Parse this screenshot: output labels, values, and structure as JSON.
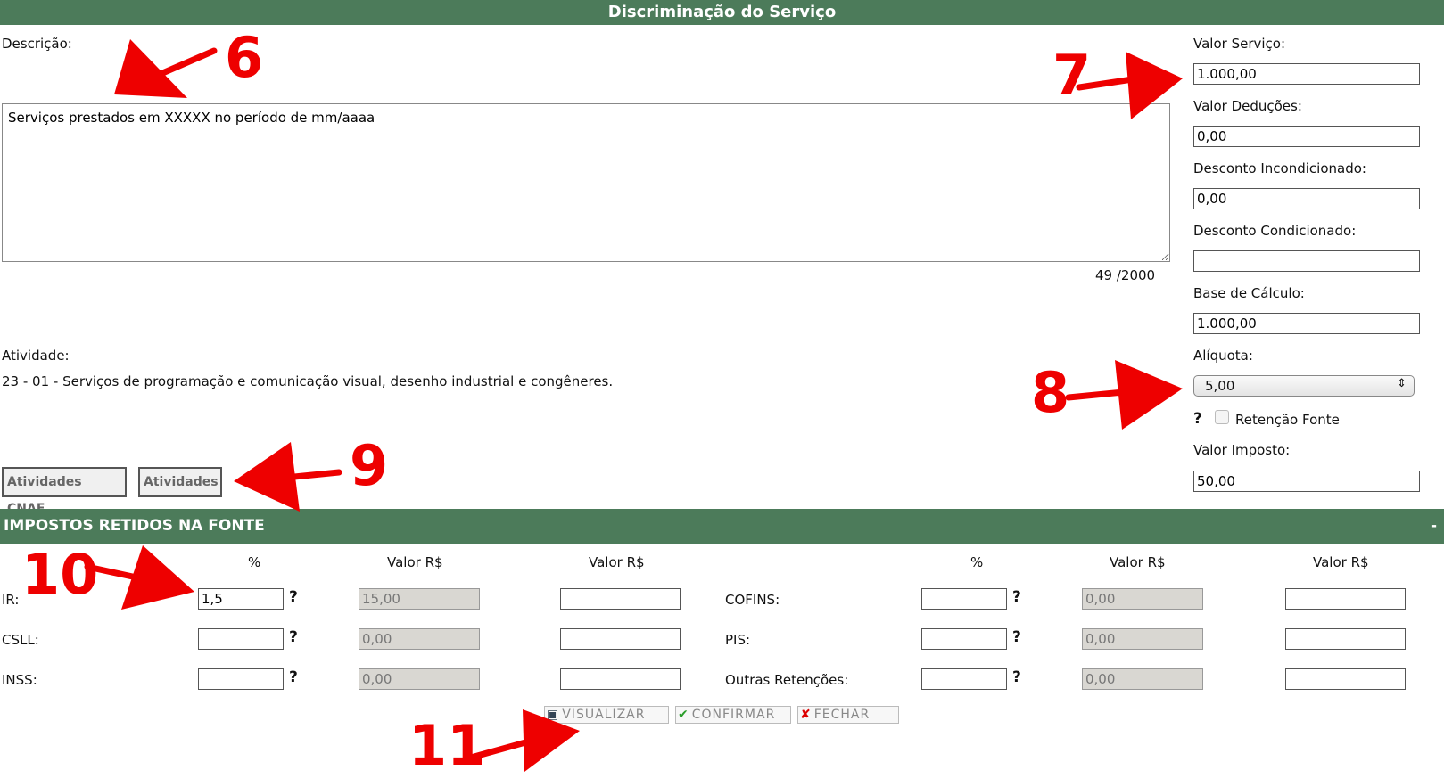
{
  "header": {
    "title": "Discriminação do Serviço"
  },
  "descricao": {
    "label": "Descrição:",
    "value": "Serviços prestados em XXXXX no período de mm/aaaa",
    "counter": "49 /2000"
  },
  "right_panel": {
    "valor_servico": {
      "label": "Valor Serviço:",
      "value": "1.000,00"
    },
    "valor_deducoes": {
      "label": "Valor Deduções:",
      "value": "0,00"
    },
    "desconto_incond": {
      "label": "Desconto Incondicionado:",
      "value": "0,00"
    },
    "desconto_cond": {
      "label": "Desconto Condicionado:",
      "value": ""
    },
    "base_calculo": {
      "label": "Base de Cálculo:",
      "value": "1.000,00"
    },
    "aliquota": {
      "label": "Alíquota:",
      "selected": "5,00"
    },
    "retencao": {
      "help": "?",
      "label": "Retenção Fonte",
      "checked": false
    },
    "valor_imposto": {
      "label": "Valor Imposto:",
      "value": "50,00"
    }
  },
  "atividade": {
    "label": "Atividade:",
    "value": "23 - 01 - Serviços de programação e comunicação visual, desenho industrial e congêneres."
  },
  "buttons": {
    "cnae": "Atividades CNAE",
    "atividades": "Atividades"
  },
  "impostos": {
    "title": "IMPOSTOS RETIDOS NA FONTE",
    "collapse": "-",
    "headers": {
      "pct": "%",
      "valor": "Valor R$"
    },
    "rows_left": [
      {
        "label": "IR:",
        "pct": "1,5",
        "valor": "15,00",
        "valor2": ""
      },
      {
        "label": "CSLL:",
        "pct": "",
        "valor": "0,00",
        "valor2": ""
      },
      {
        "label": "INSS:",
        "pct": "",
        "valor": "0,00",
        "valor2": ""
      }
    ],
    "rows_right": [
      {
        "label": "COFINS:",
        "pct": "",
        "valor": "0,00",
        "valor2": ""
      },
      {
        "label": "PIS:",
        "pct": "",
        "valor": "0,00",
        "valor2": ""
      },
      {
        "label": "Outras Retenções:",
        "pct": "",
        "valor": "0,00",
        "valor2": ""
      }
    ],
    "help": "?"
  },
  "footer_buttons": {
    "visualizar": "VISUALIZAR",
    "confirmar": "CONFIRMAR",
    "fechar": "FECHAR"
  },
  "annotations": {
    "n6": "6",
    "n7": "7",
    "n8": "8",
    "n9": "9",
    "n10": "10",
    "n11": "11",
    "color": "#ee0000"
  }
}
